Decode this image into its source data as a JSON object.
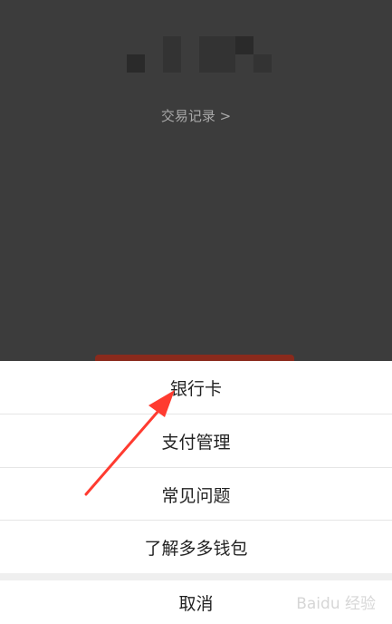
{
  "background": {
    "transactions_link": "交易记录 >"
  },
  "sheet": {
    "items": [
      {
        "label": "银行卡"
      },
      {
        "label": "支付管理"
      },
      {
        "label": "常见问题"
      },
      {
        "label": "了解多多钱包"
      }
    ],
    "cancel_label": "取消"
  },
  "annotation": {
    "arrow_color": "#ff3b30"
  },
  "watermark": {
    "text": "Baidu 经验"
  }
}
